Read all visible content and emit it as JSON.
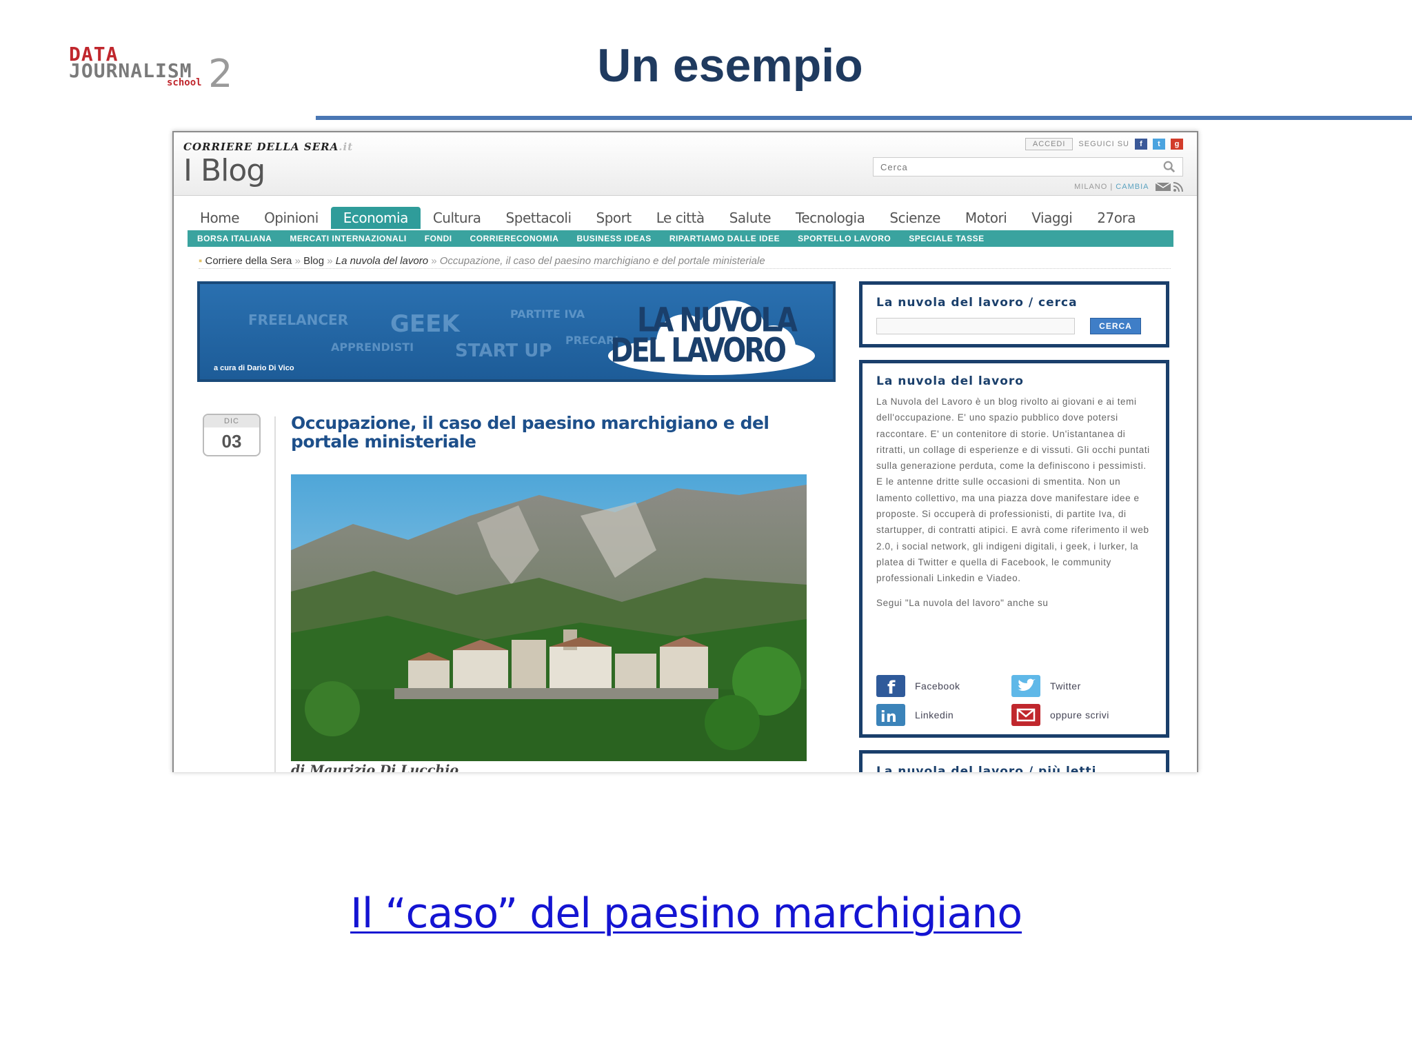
{
  "slide": {
    "title": "Un esempio",
    "logo": {
      "data": "DATA",
      "journalism": "JOURNALISM",
      "school": "school",
      "number": "2"
    },
    "link_text": "Il “caso” del paesino marchigiano"
  },
  "site": {
    "brand": "CORRIERE DELLA SERA",
    "brand_suffix": ".it",
    "blog_title": "I Blog",
    "accedi": "ACCEDI",
    "seguici": "SEGUICI SU",
    "search_placeholder": "Cerca",
    "city": "MILANO",
    "city_sep": "|",
    "cambia": "CAMBIA"
  },
  "nav": [
    "Home",
    "Opinioni",
    "Economia",
    "Cultura",
    "Spettacoli",
    "Sport",
    "Le città",
    "Salute",
    "Tecnologia",
    "Scienze",
    "Motori",
    "Viaggi",
    "27ora"
  ],
  "nav_active": "Economia",
  "subnav": [
    "BORSA ITALIANA",
    "MERCATI INTERNAZIONALI",
    "FONDI",
    "CORRIERECONOMIA",
    "BUSINESS IDEAS",
    "RIPARTIAMO DALLE IDEE",
    "SPORTELLO LAVORO",
    "SPECIALE TASSE"
  ],
  "breadcrumb": {
    "home": "Corriere della Sera",
    "sep": "»",
    "blog": "Blog",
    "section": "La nuvola del lavoro",
    "current": "Occupazione, il caso del paesino marchigiano e del portale ministeriale"
  },
  "banner": {
    "title_line1": "LA NUVOLA",
    "title_line2": "DEL LAVORO",
    "credit": "a cura di Dario Di Vico",
    "words": [
      "FREELANCER",
      "GEEK",
      "PARTITE IVA",
      "APPRENDISTI",
      "START UP",
      "PRECARI"
    ]
  },
  "post": {
    "date_month": "DIC",
    "date_day": "03",
    "title": "Occupazione, il caso del paesino marchigiano e del portale ministeriale",
    "byline": "di Maurizio Di Lucchio"
  },
  "sidebar": {
    "search_title": "La nuvola del lavoro / cerca",
    "search_button": "CERCA",
    "about_title": "La nuvola del lavoro",
    "about_text": "La Nuvola del Lavoro è un blog rivolto ai giovani e ai temi dell'occupazione. E' uno spazio pubblico dove potersi raccontare. E' un contenitore di storie. Un'istantanea di ritratti, un collage di esperienze e di vissuti. Gli occhi puntati sulla generazione perduta, come la definiscono i pessimisti. E le antenne dritte sulle occasioni di smentita. Non un lamento collettivo, ma una piazza dove manifestare idee e proposte. Si occuperà di professionisti, di partite Iva, di startupper, di contratti atipici. E avrà come riferimento il web 2.0, i social network, gli indigeni digitali, i geek, i lurker, la platea di Twitter e quella di Facebook, le community professionali Linkedin e Viadeo.",
    "segui_text": "Segui \"La nuvola del lavoro\" anche su",
    "social": {
      "facebook": "Facebook",
      "twitter": "Twitter",
      "linkedin": "Linkedin",
      "email": "oppure scrivi"
    },
    "top_title": "La nuvola del lavoro / più letti"
  },
  "colors": {
    "title": "#1f3a5f",
    "rule": "#4a77b4",
    "teal": "#3aa39f",
    "navy": "#1a3f6b",
    "link": "#1414d2"
  }
}
